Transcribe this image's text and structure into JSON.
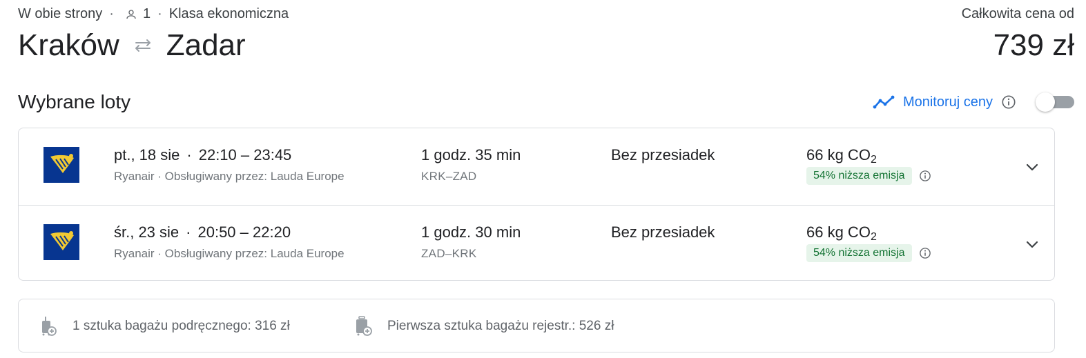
{
  "header": {
    "trip_type": "W obie strony",
    "passengers": "1",
    "cabin_class": "Klasa ekonomiczna",
    "origin": "Kraków",
    "destination": "Zadar",
    "price_label": "Całkowita cena od",
    "price_value": "739 zł"
  },
  "section": {
    "title": "Wybrane loty",
    "monitor_label": "Monitoruj ceny",
    "monitor_toggle_on": false
  },
  "flights": [
    {
      "date": "pt., 18 sie",
      "times": "22:10 – 23:45",
      "airline": "Ryanair · Obsługiwany przez: Lauda Europe",
      "duration": "1 godz. 35 min",
      "route_codes": "KRK–ZAD",
      "stops": "Bez przesiadek",
      "co2_value": "66 kg CO",
      "co2_sub": "2",
      "emission_badge": "54% niższa emisja"
    },
    {
      "date": "śr., 23 sie",
      "times": "20:50 – 22:20",
      "airline": "Ryanair · Obsługiwany przez: Lauda Europe",
      "duration": "1 godz. 30 min",
      "route_codes": "ZAD–KRK",
      "stops": "Bez przesiadek",
      "co2_value": "66 kg CO",
      "co2_sub": "2",
      "emission_badge": "54% niższa emisja"
    }
  ],
  "baggage": {
    "carry_on": "1 sztuka bagażu podręcznego: 316 zł",
    "checked": "Pierwsza sztuka bagażu rejestr.: 526 zł"
  },
  "colors": {
    "accent": "#1a73e8",
    "ryanair_blue": "#073590",
    "ryanair_yellow": "#f1c933",
    "emission_bg": "#e6f4ea",
    "emission_text": "#137333"
  },
  "icons": {
    "person": "person-icon",
    "swap": "swap-arrows-icon",
    "trend": "price-trend-icon",
    "info": "info-icon",
    "chevron": "chevron-down-icon",
    "carry_on": "carry-on-bag-icon",
    "checked_bag": "checked-bag-icon",
    "airline": "ryanair-logo-icon"
  }
}
